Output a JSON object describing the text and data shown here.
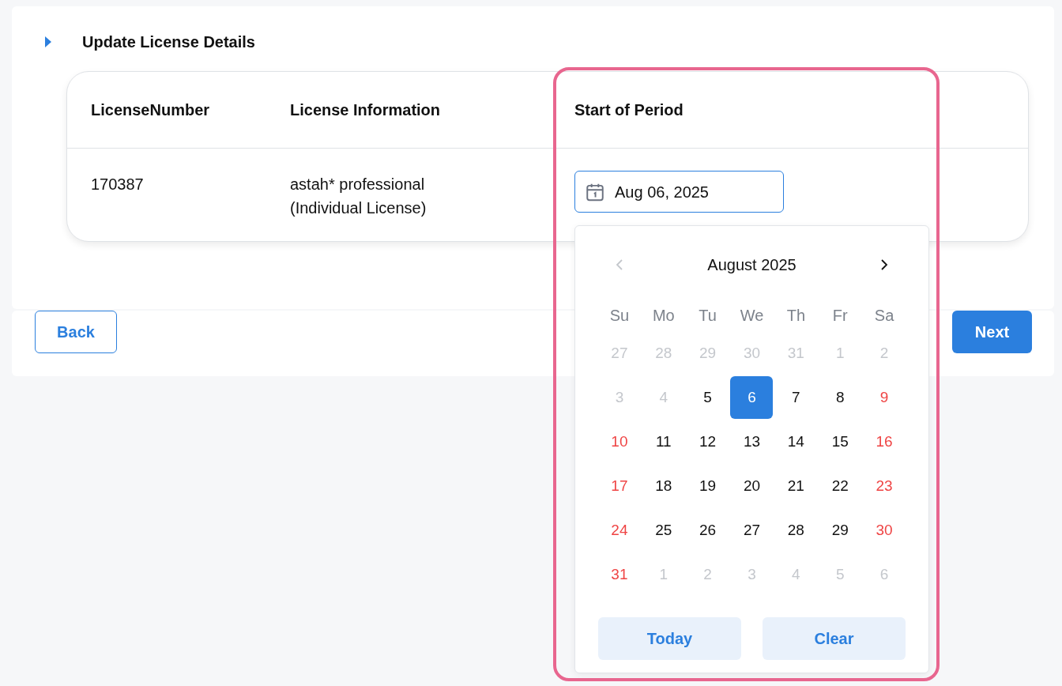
{
  "section": {
    "title": "Update License Details",
    "expanded": false
  },
  "table": {
    "columns": [
      "LicenseNumber",
      "License Information",
      "Start of Period"
    ],
    "rows": [
      {
        "license_number": "170387",
        "license_information": [
          "astah* professional",
          "(Individual License)"
        ],
        "start_of_period": "Aug 06, 2025"
      }
    ]
  },
  "datepicker": {
    "month_title": "August 2025",
    "prev_disabled": true,
    "next_disabled": false,
    "weekdays": [
      "Su",
      "Mo",
      "Tu",
      "We",
      "Th",
      "Fr",
      "Sa"
    ],
    "weeks": [
      [
        {
          "day": "27",
          "kind": "outside",
          "selected": false
        },
        {
          "day": "28",
          "kind": "outside",
          "selected": false
        },
        {
          "day": "29",
          "kind": "outside",
          "selected": false
        },
        {
          "day": "30",
          "kind": "outside",
          "selected": false
        },
        {
          "day": "31",
          "kind": "outside",
          "selected": false
        },
        {
          "day": "1",
          "kind": "outside",
          "selected": false
        },
        {
          "day": "2",
          "kind": "outside",
          "selected": false
        }
      ],
      [
        {
          "day": "3",
          "kind": "outside",
          "selected": false
        },
        {
          "day": "4",
          "kind": "outside",
          "selected": false
        },
        {
          "day": "5",
          "kind": "weekday",
          "selected": false
        },
        {
          "day": "6",
          "selected": true
        },
        {
          "day": "7",
          "kind": "weekday",
          "selected": false
        },
        {
          "day": "8",
          "kind": "weekday",
          "selected": false
        },
        {
          "day": "9",
          "kind": "weekend",
          "selected": false
        }
      ],
      [
        {
          "day": "10",
          "kind": "weekend",
          "selected": false
        },
        {
          "day": "11",
          "kind": "weekday",
          "selected": false
        },
        {
          "day": "12",
          "kind": "weekday",
          "selected": false
        },
        {
          "day": "13",
          "kind": "weekday",
          "selected": false
        },
        {
          "day": "14",
          "kind": "weekday",
          "selected": false
        },
        {
          "day": "15",
          "kind": "weekday",
          "selected": false
        },
        {
          "day": "16",
          "kind": "weekend",
          "selected": false
        }
      ],
      [
        {
          "day": "17",
          "kind": "weekend",
          "selected": false
        },
        {
          "day": "18",
          "kind": "weekday",
          "selected": false
        },
        {
          "day": "19",
          "kind": "weekday",
          "selected": false
        },
        {
          "day": "20",
          "kind": "weekday",
          "selected": false
        },
        {
          "day": "21",
          "kind": "weekday",
          "selected": false
        },
        {
          "day": "22",
          "kind": "weekday",
          "selected": false
        },
        {
          "day": "23",
          "kind": "weekend",
          "selected": false
        }
      ],
      [
        {
          "day": "24",
          "kind": "weekend",
          "selected": false
        },
        {
          "day": "25",
          "kind": "weekday",
          "selected": false
        },
        {
          "day": "26",
          "kind": "weekday",
          "selected": false
        },
        {
          "day": "27",
          "kind": "weekday",
          "selected": false
        },
        {
          "day": "28",
          "kind": "weekday",
          "selected": false
        },
        {
          "day": "29",
          "kind": "weekday",
          "selected": false
        },
        {
          "day": "30",
          "kind": "weekend",
          "selected": false
        }
      ],
      [
        {
          "day": "31",
          "kind": "weekend",
          "selected": false
        },
        {
          "day": "1",
          "kind": "outside",
          "selected": false
        },
        {
          "day": "2",
          "kind": "outside",
          "selected": false
        },
        {
          "day": "3",
          "kind": "outside",
          "selected": false
        },
        {
          "day": "4",
          "kind": "outside",
          "selected": false
        },
        {
          "day": "5",
          "kind": "outside",
          "selected": false
        },
        {
          "day": "6",
          "kind": "outside",
          "selected": false
        }
      ]
    ],
    "buttons": [
      "Today",
      "Clear"
    ]
  },
  "footer": {
    "back": "Back",
    "next": "Next"
  }
}
